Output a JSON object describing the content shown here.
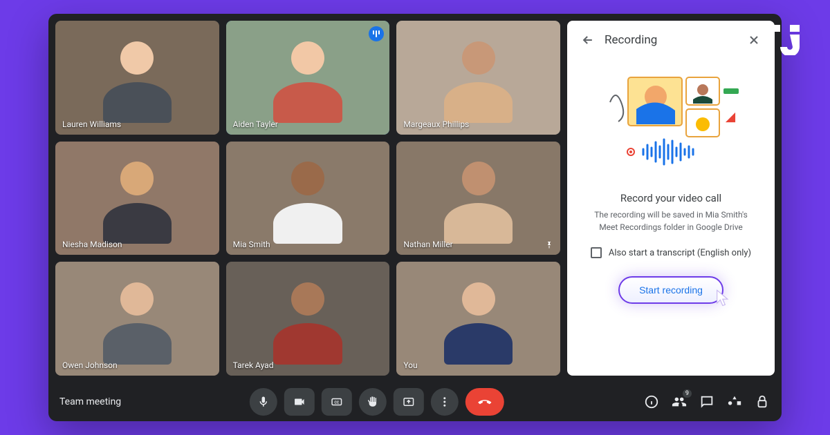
{
  "meeting_title": "Team meeting",
  "participant_badge": "9",
  "participants": [
    {
      "name": "Lauren Williams",
      "bg": "#7a6a5a",
      "skin": "#f0c9a8",
      "shirt": "#4a5058",
      "active": false
    },
    {
      "name": "Aiden Tayler",
      "bg": "#8aa088",
      "skin": "#f2c8a6",
      "shirt": "#c85a4a",
      "active": true
    },
    {
      "name": "Margeaux Phillips",
      "bg": "#b8a898",
      "skin": "#c89878",
      "shirt": "#d8b088",
      "active": false
    },
    {
      "name": "Niesha Madison",
      "bg": "#907868",
      "skin": "#d8a878",
      "shirt": "#3a3a42",
      "active": false
    },
    {
      "name": "Mia Smith",
      "bg": "#8a7a6a",
      "skin": "#9a6a4a",
      "shirt": "#f0f0f0",
      "active": false
    },
    {
      "name": "Nathan Miller",
      "bg": "#887868",
      "skin": "#c09070",
      "shirt": "#d8b898",
      "active": false
    },
    {
      "name": "Owen Johnson",
      "bg": "#988878",
      "skin": "#e0b898",
      "shirt": "#5a6068",
      "active": false
    },
    {
      "name": "Tarek Ayad",
      "bg": "#686058",
      "skin": "#a87858",
      "shirt": "#a03830",
      "active": false
    },
    {
      "name": "You",
      "bg": "#988878",
      "skin": "#e0b898",
      "shirt": "#2a3a68",
      "active": false
    }
  ],
  "sidebar": {
    "title": "Recording",
    "heading": "Record your video call",
    "description": "The recording will be saved in Mia Smith's Meet Recordings folder in Google Drive",
    "checkbox_label": "Also start a transcript (English only)",
    "button_label": "Start recording"
  }
}
